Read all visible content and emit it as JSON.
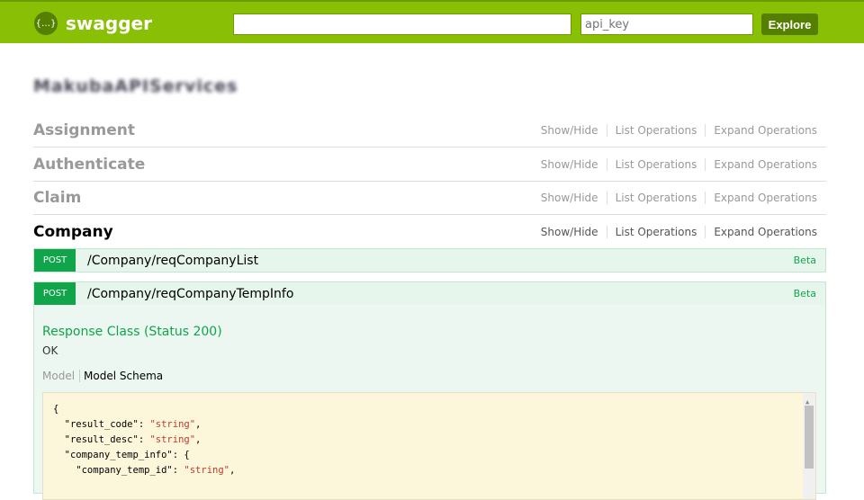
{
  "header": {
    "logo_icon": "{…}",
    "logo_text": "swagger",
    "url_value": "",
    "api_key_placeholder": "api_key",
    "explore_label": "Explore"
  },
  "title": "MakubaAPIServices",
  "ops_labels": {
    "show_hide": "Show/Hide",
    "list": "List Operations",
    "expand": "Expand Operations"
  },
  "resources": [
    {
      "name": "Assignment"
    },
    {
      "name": "Authenticate"
    },
    {
      "name": "Claim"
    },
    {
      "name": "Company"
    }
  ],
  "operations": [
    {
      "method": "POST",
      "path": "/Company/reqCompanyList",
      "tag": "Beta"
    },
    {
      "method": "POST",
      "path": "/Company/reqCompanyTempInfo",
      "tag": "Beta"
    }
  ],
  "panel": {
    "response_class": "Response Class (Status 200)",
    "status_text": "OK",
    "tab_model": "Model",
    "tab_schema": "Model Schema"
  },
  "code": {
    "l0": "{",
    "k1": "  \"result_code\": ",
    "v1": "\"string\"",
    "k2": "  \"result_desc\": ",
    "v2": "\"string\"",
    "k3": "  \"company_temp_info\": {",
    "k4": "    \"company_temp_id\": ",
    "v4": "\"string\""
  }
}
